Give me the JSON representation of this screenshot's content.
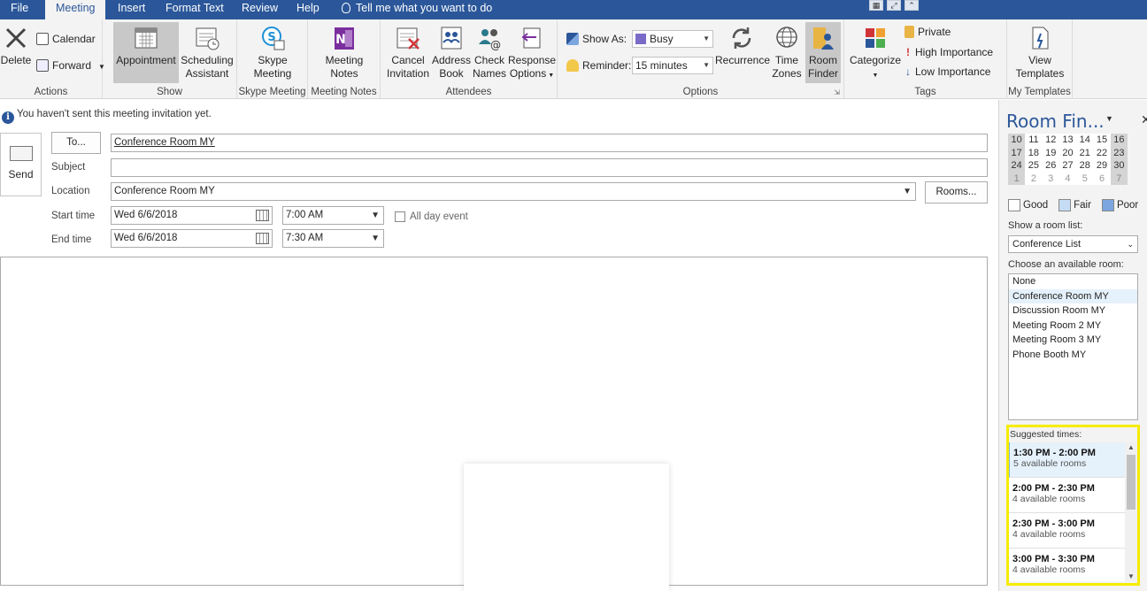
{
  "tabs": [
    "File",
    "Meeting",
    "Insert",
    "Format Text",
    "Review",
    "Help"
  ],
  "tell_me": "Tell me what you want to do",
  "ribbon": {
    "actions": {
      "label": "Actions",
      "delete": "Delete",
      "calendar": "Calendar",
      "forward": "Forward"
    },
    "show": {
      "label": "Show",
      "appointment": "Appointment",
      "scheduling1": "Scheduling",
      "scheduling2": "Assistant"
    },
    "skype": {
      "label": "Skype Meeting",
      "btn1": "Skype",
      "btn2": "Meeting"
    },
    "notes": {
      "label": "Meeting Notes",
      "btn1": "Meeting",
      "btn2": "Notes"
    },
    "attendees": {
      "label": "Attendees",
      "cancel1": "Cancel",
      "cancel2": "Invitation",
      "address1": "Address",
      "address2": "Book",
      "check1": "Check",
      "check2": "Names",
      "response1": "Response",
      "response2": "Options"
    },
    "options": {
      "label": "Options",
      "show_as": "Show As:",
      "show_as_value": "Busy",
      "reminder": "Reminder:",
      "reminder_value": "15 minutes",
      "recurrence": "Recurrence",
      "tz1": "Time",
      "tz2": "Zones",
      "rf1": "Room",
      "rf2": "Finder"
    },
    "tags": {
      "label": "Tags",
      "categorize": "Categorize",
      "private": "Private",
      "high": "High Importance",
      "low": "Low Importance"
    },
    "templates": {
      "label": "My Templates",
      "view1": "View",
      "view2": "Templates"
    }
  },
  "info": "You haven't sent this meeting invitation yet.",
  "form": {
    "send": "Send",
    "to_button": "To...",
    "to_value": "Conference Room MY",
    "subject_label": "Subject",
    "subject_value": "",
    "location_label": "Location",
    "location_value": "Conference Room MY",
    "rooms_button": "Rooms...",
    "start_label": "Start time",
    "start_date": "Wed 6/6/2018",
    "start_time": "7:00 AM",
    "all_day": "All day event",
    "end_label": "End time",
    "end_date": "Wed 6/6/2018",
    "end_time": "7:30 AM"
  },
  "pane": {
    "title": "Room Fin...",
    "calendar_rows": [
      [
        "10",
        "11",
        "12",
        "13",
        "14",
        "15",
        "16"
      ],
      [
        "17",
        "18",
        "19",
        "20",
        "21",
        "22",
        "23"
      ],
      [
        "24",
        "25",
        "26",
        "27",
        "28",
        "29",
        "30"
      ],
      [
        "1",
        "2",
        "3",
        "4",
        "5",
        "6",
        "7"
      ]
    ],
    "legend": {
      "good": "Good",
      "fair": "Fair",
      "poor": "Poor"
    },
    "legend_colors": {
      "good": "#ffffff",
      "fair": "#c6dcf4",
      "poor": "#7ba6e0"
    },
    "show_room_list": "Show a room list:",
    "room_list_value": "Conference List",
    "choose_room": "Choose an available room:",
    "rooms": [
      "None",
      "Conference Room MY",
      "Discussion Room MY",
      "Meeting Room 2 MY",
      "Meeting Room 3 MY",
      "Phone Booth MY"
    ],
    "suggested_label": "Suggested times:",
    "suggestions": [
      {
        "time": "1:30 PM - 2:00 PM",
        "count": "5 available rooms"
      },
      {
        "time": "2:00 PM - 2:30 PM",
        "count": "4 available rooms"
      },
      {
        "time": "2:30 PM - 3:00 PM",
        "count": "4 available rooms"
      },
      {
        "time": "3:00 PM - 3:30 PM",
        "count": "4 available rooms"
      }
    ]
  },
  "colors": {
    "accent": "#2b579a",
    "highlight": "#f5ec00"
  }
}
